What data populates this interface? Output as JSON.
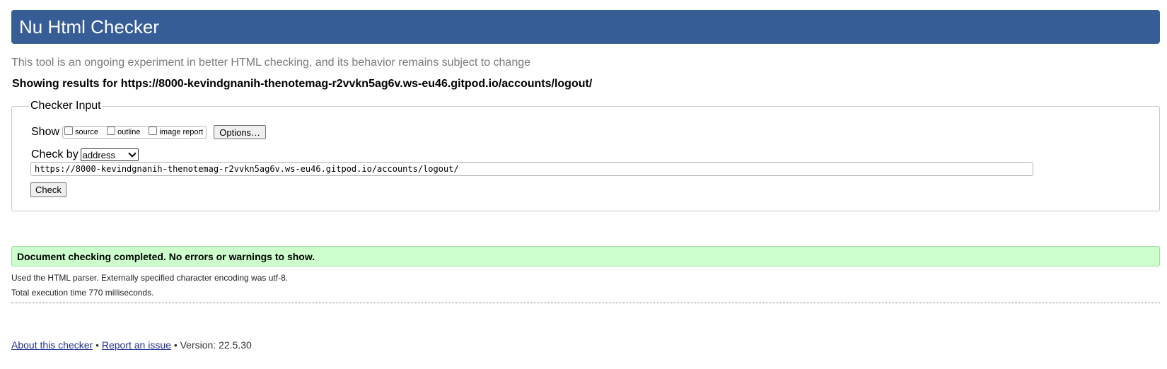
{
  "header": {
    "title": "Nu Html Checker"
  },
  "subtitle": "This tool is an ongoing experiment in better HTML checking, and its behavior remains subject to change",
  "results_for": "Showing results for https://8000-kevindgnanih-thenotemag-r2vvkn5ag6v.ws-eu46.gitpod.io/accounts/logout/",
  "checker_input": {
    "legend": "Checker Input",
    "show_label": "Show",
    "show_options": [
      "source",
      "outline",
      "image report"
    ],
    "options_button": "Options…",
    "check_by_label": "Check by",
    "check_by_selected": "address",
    "url_value": "https://8000-kevindgnanih-thenotemag-r2vvkn5ag6v.ws-eu46.gitpod.io/accounts/logout/",
    "check_button": "Check"
  },
  "result": {
    "success_message": "Document checking completed. No errors or warnings to show.",
    "parser_info": "Used the HTML parser. Externally specified character encoding was utf-8.",
    "execution_time": "Total execution time 770 milliseconds."
  },
  "footer": {
    "about_link": "About this checker",
    "separator": "•",
    "report_link": "Report an issue",
    "version": "Version: 22.5.30"
  },
  "colors": {
    "header_bg": "#365d95",
    "success_bg": "#ccffcc",
    "link": "#1f2f8e"
  }
}
